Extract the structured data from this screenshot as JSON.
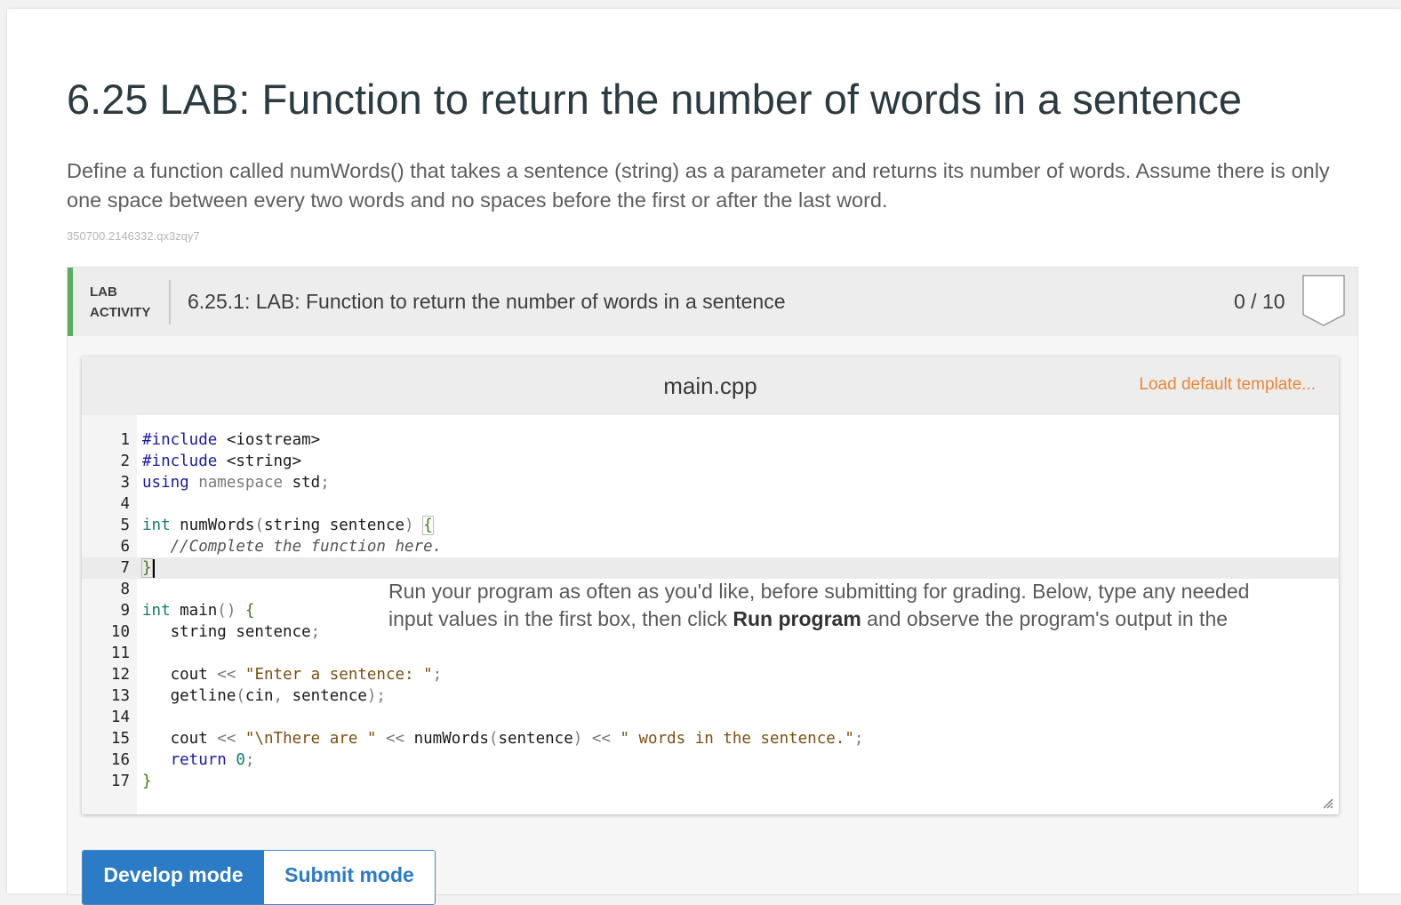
{
  "page": {
    "title": "6.25 LAB: Function to return the number of words in a sentence",
    "description": "Define a function called numWords() that takes a sentence (string) as a parameter and returns its number of words. Assume there is only one space between every two words and no spaces before the first or after the last word.",
    "reference_id": "350700.2146332.qx3zqy7"
  },
  "lab": {
    "tag_line1": "LAB",
    "tag_line2": "ACTIVITY",
    "title": "6.25.1: LAB: Function to return the number of words in a sentence",
    "score": "0 / 10",
    "accent_color": "#5aac5f"
  },
  "editor": {
    "file_name": "main.cpp",
    "load_template_label": "Load default template...",
    "active_line": 7,
    "lines": [
      {
        "n": "1",
        "tokens": [
          {
            "t": "#include",
            "c": "#1b1b9e"
          },
          {
            "t": " <iostream>",
            "c": "#1a1a1a"
          }
        ]
      },
      {
        "n": "2",
        "tokens": [
          {
            "t": "#include",
            "c": "#1b1b9e"
          },
          {
            "t": " <string>",
            "c": "#1a1a1a"
          }
        ]
      },
      {
        "n": "3",
        "tokens": [
          {
            "t": "using",
            "c": "#1b1b9e"
          },
          {
            "t": " ",
            "c": "#1a1a1a"
          },
          {
            "t": "namespace",
            "c": "#7a7a7a"
          },
          {
            "t": " std",
            "c": "#1a1a1a"
          },
          {
            "t": ";",
            "c": "#7a7a7a"
          }
        ]
      },
      {
        "n": "4",
        "tokens": []
      },
      {
        "n": "5",
        "tokens": [
          {
            "t": "int",
            "c": "#127a6e"
          },
          {
            "t": " numWords",
            "c": "#1a1a1a"
          },
          {
            "t": "(",
            "c": "#7a7a7a"
          },
          {
            "t": "string sentence",
            "c": "#1a1a1a"
          },
          {
            "t": ")",
            "c": "#7a7a7a"
          },
          {
            "t": " ",
            "c": "#1a1a1a"
          },
          {
            "t": "{",
            "c": "#3e7a1c",
            "mb": true
          }
        ]
      },
      {
        "n": "6",
        "tokens": [
          {
            "t": "   //Complete the function here.",
            "c": "#555555",
            "i": true
          }
        ]
      },
      {
        "n": "7",
        "tokens": [
          {
            "t": "}",
            "c": "#3e7a1c",
            "mb": true
          }
        ],
        "caret": true
      },
      {
        "n": "8",
        "tokens": []
      },
      {
        "n": "9",
        "tokens": [
          {
            "t": "int",
            "c": "#127a6e"
          },
          {
            "t": " main",
            "c": "#1a1a1a"
          },
          {
            "t": "()",
            "c": "#7a7a7a"
          },
          {
            "t": " ",
            "c": "#1a1a1a"
          },
          {
            "t": "{",
            "c": "#3e7a1c"
          }
        ]
      },
      {
        "n": "10",
        "tokens": [
          {
            "t": "   string sentence",
            "c": "#1a1a1a"
          },
          {
            "t": ";",
            "c": "#7a7a7a"
          }
        ]
      },
      {
        "n": "11",
        "tokens": []
      },
      {
        "n": "12",
        "tokens": [
          {
            "t": "   cout ",
            "c": "#1a1a1a"
          },
          {
            "t": "<<",
            "c": "#7a7a7a"
          },
          {
            "t": " ",
            "c": "#1a1a1a"
          },
          {
            "t": "\"Enter a sentence: \"",
            "c": "#7a4f12"
          },
          {
            "t": ";",
            "c": "#7a7a7a"
          }
        ]
      },
      {
        "n": "13",
        "tokens": [
          {
            "t": "   getline",
            "c": "#1a1a1a"
          },
          {
            "t": "(",
            "c": "#7a7a7a"
          },
          {
            "t": "cin",
            "c": "#1a1a1a"
          },
          {
            "t": ",",
            "c": "#7a7a7a"
          },
          {
            "t": " sentence",
            "c": "#1a1a1a"
          },
          {
            "t": ");",
            "c": "#7a7a7a"
          }
        ]
      },
      {
        "n": "14",
        "tokens": []
      },
      {
        "n": "15",
        "tokens": [
          {
            "t": "   cout ",
            "c": "#1a1a1a"
          },
          {
            "t": "<<",
            "c": "#7a7a7a"
          },
          {
            "t": " ",
            "c": "#1a1a1a"
          },
          {
            "t": "\"\\nThere are \"",
            "c": "#7a4f12"
          },
          {
            "t": " ",
            "c": "#1a1a1a"
          },
          {
            "t": "<<",
            "c": "#7a7a7a"
          },
          {
            "t": " numWords",
            "c": "#1a1a1a"
          },
          {
            "t": "(",
            "c": "#7a7a7a"
          },
          {
            "t": "sentence",
            "c": "#1a1a1a"
          },
          {
            "t": ")",
            "c": "#7a7a7a"
          },
          {
            "t": " ",
            "c": "#1a1a1a"
          },
          {
            "t": "<<",
            "c": "#7a7a7a"
          },
          {
            "t": " ",
            "c": "#1a1a1a"
          },
          {
            "t": "\" words in the sentence.\"",
            "c": "#7a4f12"
          },
          {
            "t": ";",
            "c": "#7a7a7a"
          }
        ]
      },
      {
        "n": "16",
        "tokens": [
          {
            "t": "   return",
            "c": "#1b1b9e"
          },
          {
            "t": " ",
            "c": "#1a1a1a"
          },
          {
            "t": "0",
            "c": "#127a6e"
          },
          {
            "t": ";",
            "c": "#7a7a7a"
          }
        ]
      },
      {
        "n": "17",
        "tokens": [
          {
            "t": "}",
            "c": "#3e7a1c"
          }
        ]
      }
    ]
  },
  "modes": {
    "develop_label": "Develop mode",
    "submit_label": "Submit mode",
    "active": "develop"
  },
  "instructions": {
    "text_before": "Run your program as often as you'd like, before submitting for grading. Below, type any needed input values in the first box, then click ",
    "bold": "Run program",
    "text_after": " and observe the program's output in the"
  },
  "colors": {
    "primary_blue": "#2b7bc6",
    "link_orange": "#e6873a"
  }
}
